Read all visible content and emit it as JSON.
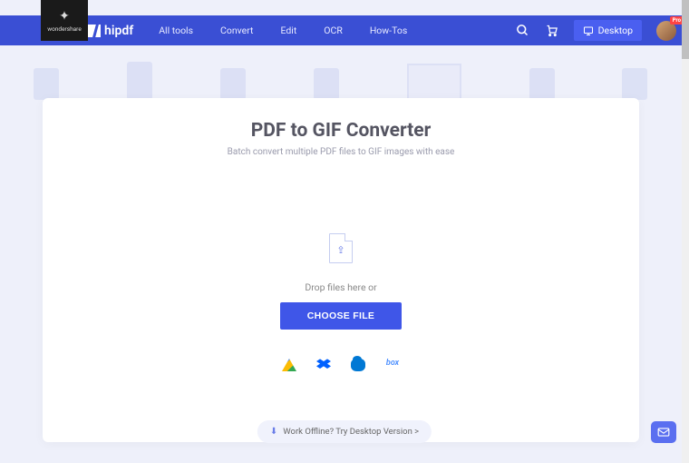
{
  "brand_badge": {
    "name": "wondershare"
  },
  "logo": {
    "text": "hipdf"
  },
  "nav": {
    "links": [
      "All tools",
      "Convert",
      "Edit",
      "OCR",
      "How-Tos"
    ],
    "desktop_label": "Desktop",
    "pro_badge": "Pro"
  },
  "page": {
    "title": "PDF to GIF Converter",
    "subtitle": "Batch convert multiple PDF files to GIF images with ease"
  },
  "drop": {
    "hint": "Drop files here or",
    "button": "CHOOSE FILE"
  },
  "cloud_providers": [
    "google-drive",
    "dropbox",
    "onedrive",
    "box"
  ],
  "box_label": "box",
  "offline": {
    "text": "Work Offline? Try Desktop Version >"
  }
}
